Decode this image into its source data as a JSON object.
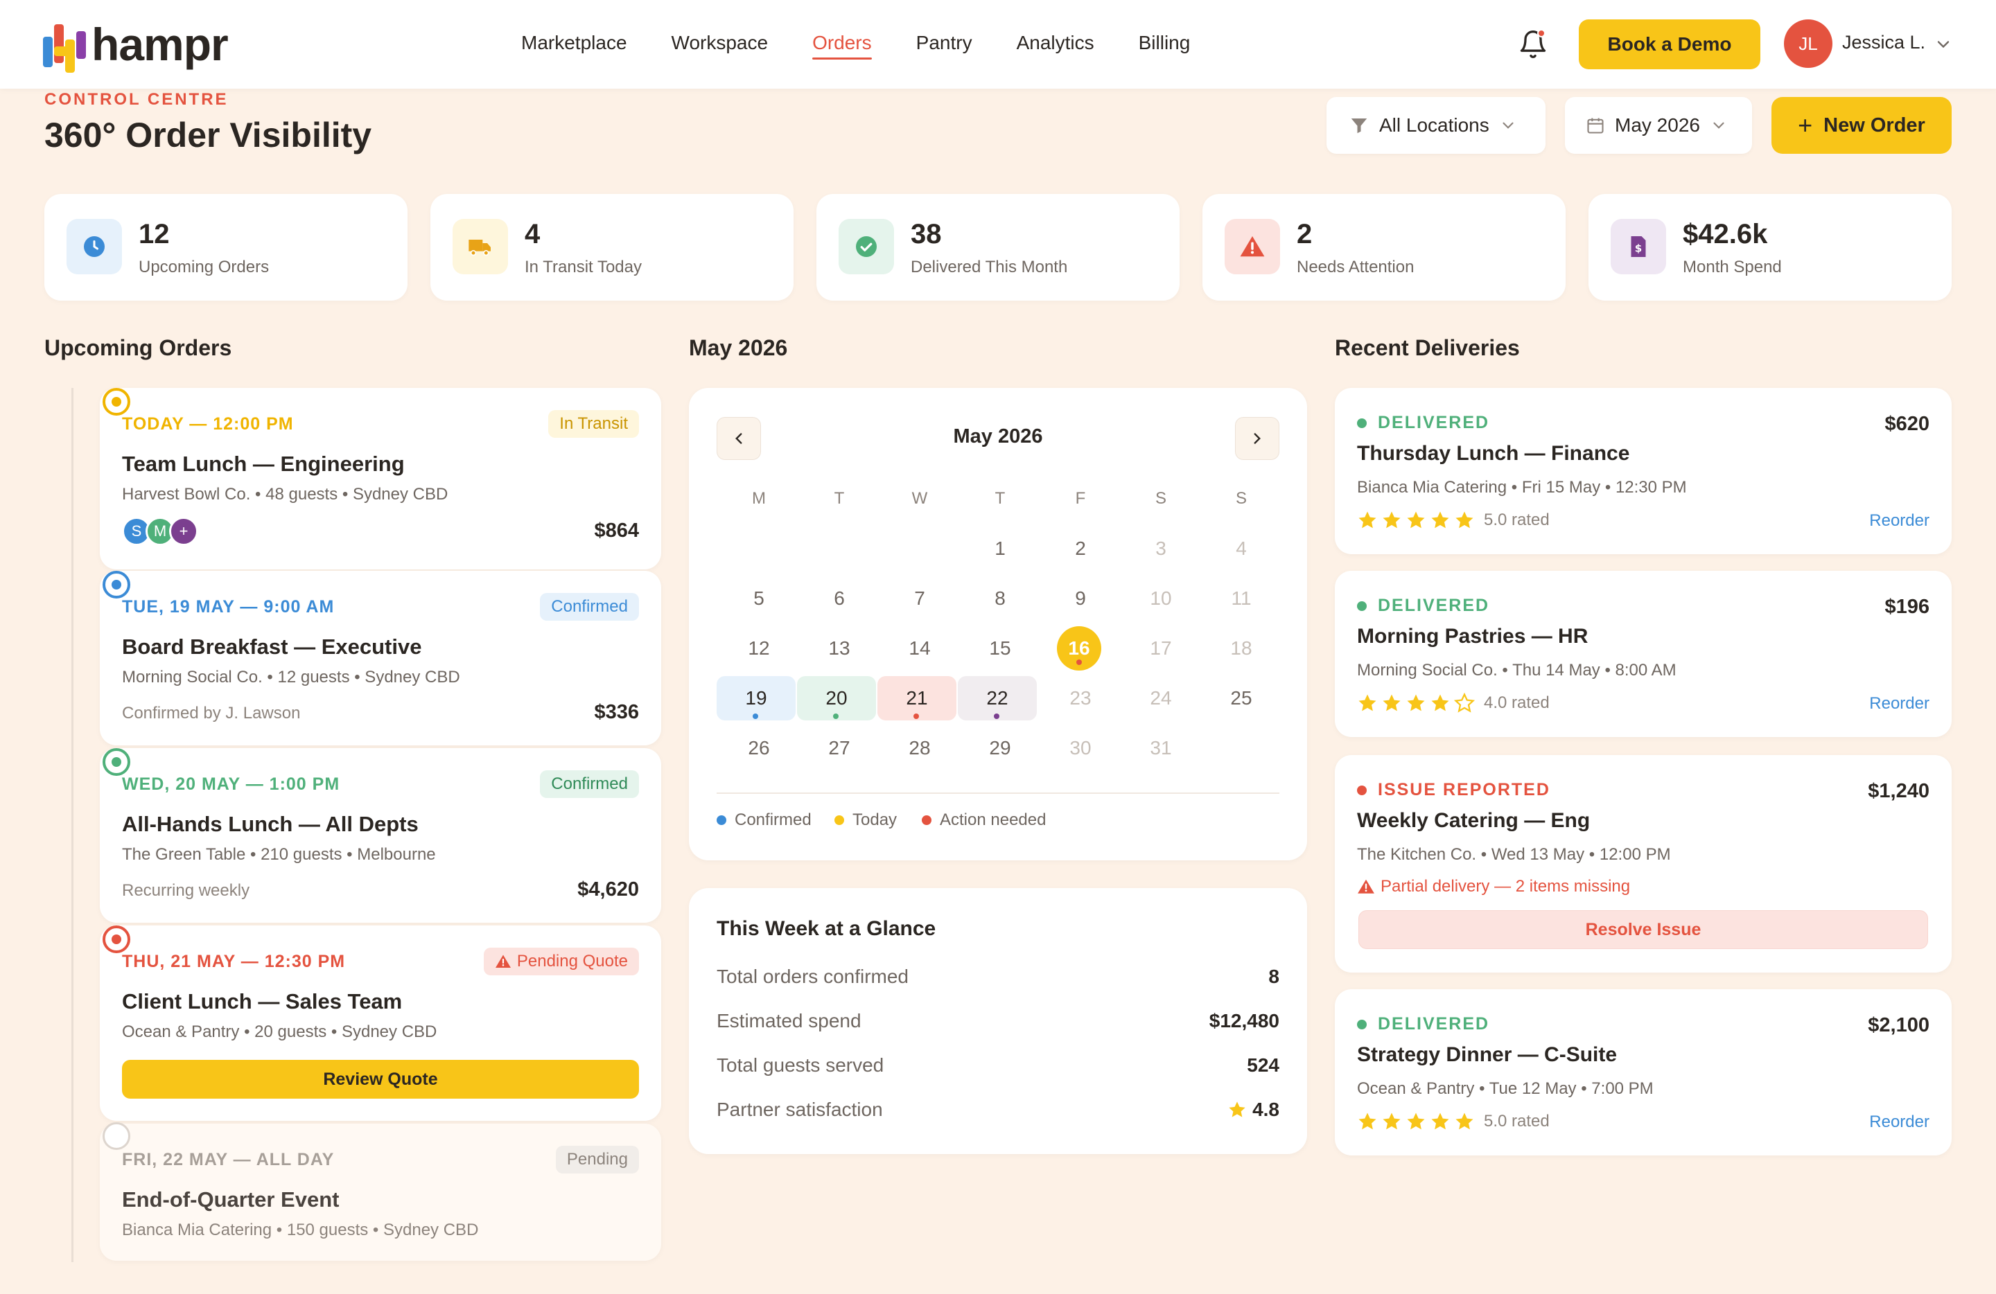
{
  "brand": {
    "name": "hampr"
  },
  "nav": {
    "items": [
      "Marketplace",
      "Workspace",
      "Orders",
      "Pantry",
      "Analytics",
      "Billing"
    ],
    "active": "Orders",
    "demo_label": "Book a Demo",
    "user_initials": "JL",
    "user_name": "Jessica L."
  },
  "header": {
    "eyebrow": "CONTROL CENTRE",
    "title": "360° Order Visibility",
    "location_filter": "All Locations",
    "date_filter": "May 2026",
    "new_order_label": "New Order"
  },
  "kpis": [
    {
      "value": "12",
      "label": "Upcoming Orders",
      "icon": "clock-icon"
    },
    {
      "value": "4",
      "label": "In Transit Today",
      "icon": "truck-icon"
    },
    {
      "value": "38",
      "label": "Delivered This Month",
      "icon": "check-circle-icon"
    },
    {
      "value": "2",
      "label": "Needs Attention",
      "icon": "warning-icon"
    },
    {
      "value": "$42.6k",
      "label": "Month Spend",
      "icon": "invoice-icon"
    }
  ],
  "sections": {
    "upcoming": "Upcoming Orders",
    "calendar": "May 2026",
    "recent": "Recent Deliveries"
  },
  "orders": [
    {
      "time": "TODAY — 12:00 PM",
      "status": "In Transit",
      "title": "Team Lunch — Engineering",
      "meta": "Harvest Bowl Co. • 48 guests • Sydney CBD",
      "avatars": [
        "S",
        "M",
        "+"
      ],
      "amount": "$864"
    },
    {
      "time": "TUE, 19 MAY — 9:00 AM",
      "status": "Confirmed",
      "title": "Board Breakfast — Executive",
      "meta": "Morning Social Co. • 12 guests • Sydney CBD",
      "note": "Confirmed by J. Lawson",
      "amount": "$336"
    },
    {
      "time": "WED, 20 MAY — 1:00 PM",
      "status": "Confirmed",
      "title": "All-Hands Lunch — All Depts",
      "meta": "The Green Table • 210 guests • Melbourne",
      "note": "Recurring weekly",
      "amount": "$4,620"
    },
    {
      "time": "THU, 21 MAY — 12:30 PM",
      "status": "Pending Quote",
      "title": "Client Lunch — Sales Team",
      "meta": "Ocean & Pantry • 20 guests • Sydney CBD",
      "action": "Review Quote"
    },
    {
      "time": "FRI, 22 MAY — ALL DAY",
      "status": "Pending",
      "title": "End-of-Quarter Event",
      "meta": "Bianca Mia Catering • 150 guests • Sydney CBD"
    }
  ],
  "calendar": {
    "month_label": "May 2026",
    "weekdays": [
      "M",
      "T",
      "W",
      "T",
      "F",
      "S",
      "S"
    ],
    "today": "16",
    "legend": [
      "Confirmed",
      "Today",
      "Action needed"
    ]
  },
  "glance": {
    "title": "This Week at a Glance",
    "rows": [
      {
        "label": "Total orders confirmed",
        "value": "8"
      },
      {
        "label": "Estimated spend",
        "value": "$12,480"
      },
      {
        "label": "Total guests served",
        "value": "524"
      },
      {
        "label": "Partner satisfaction",
        "value": "4.8"
      }
    ]
  },
  "deliveries": [
    {
      "status": "DELIVERED",
      "amount": "$620",
      "title": "Thursday Lunch — Finance",
      "meta": "Bianca Mia Catering • Fri 15 May • 12:30 PM",
      "rating": 5,
      "rated": "5.0 rated",
      "action": "Reorder"
    },
    {
      "status": "DELIVERED",
      "amount": "$196",
      "title": "Morning Pastries — HR",
      "meta": "Morning Social Co. • Thu 14 May • 8:00 AM",
      "rating": 4,
      "rated": "4.0 rated",
      "action": "Reorder"
    },
    {
      "status": "ISSUE REPORTED",
      "amount": "$1,240",
      "title": "Weekly Catering — Eng",
      "meta": "The Kitchen Co. • Wed 13 May • 12:00 PM",
      "issue": "Partial delivery — 2 items missing",
      "action": "Resolve Issue"
    },
    {
      "status": "DELIVERED",
      "amount": "$2,100",
      "title": "Strategy Dinner — C-Suite",
      "meta": "Ocean & Pantry • Tue 12 May • 7:00 PM",
      "rating": 5,
      "rated": "5.0 rated",
      "action": "Reorder"
    }
  ],
  "colors": {
    "accent": "#E4533F",
    "primary": "#F8C518",
    "confirmed": "#3B8BD6",
    "success": "#4FB07A",
    "background": "#FDF1E6"
  }
}
